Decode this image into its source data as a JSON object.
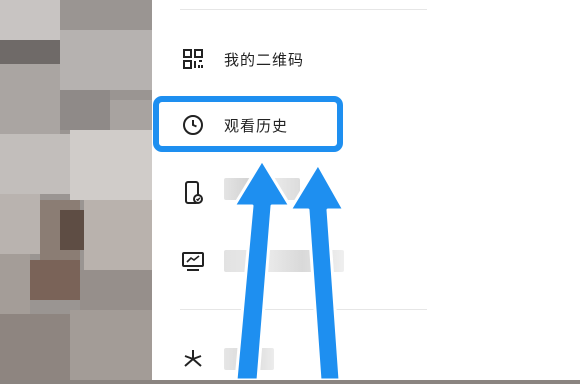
{
  "menu": {
    "items": [
      {
        "label": "我的二维码",
        "icon": "qr-code-icon"
      },
      {
        "label": "观看历史",
        "icon": "clock-icon"
      },
      {
        "label": "",
        "icon": "phone-settings-icon"
      },
      {
        "label": "",
        "icon": "monitor-chart-icon"
      },
      {
        "label": "",
        "icon": "asterisk-icon"
      }
    ]
  },
  "highlight_color": "#1e8ff0"
}
